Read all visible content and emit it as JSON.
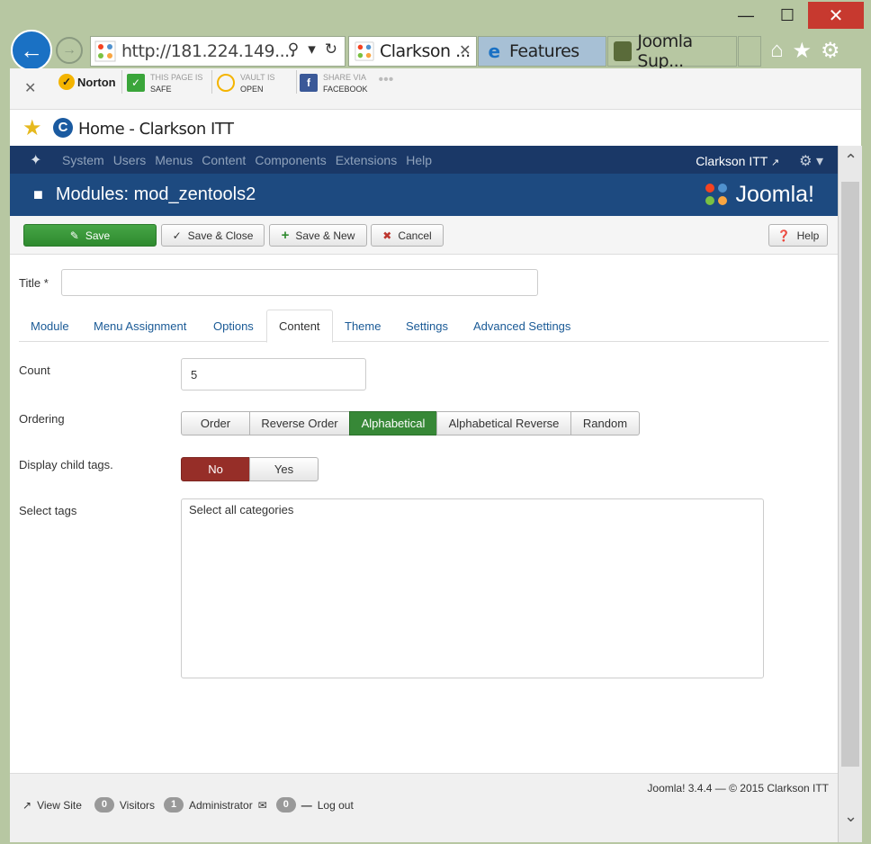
{
  "browser": {
    "url": "http://181.224.149....",
    "tabs": [
      {
        "label": "Clarkson ...",
        "active": true
      },
      {
        "label": "Features",
        "active": false
      },
      {
        "label": "Joomla Sup...",
        "active": false
      }
    ],
    "toolbar": {
      "norton": "Norton",
      "safe_top": "THIS PAGE IS",
      "safe_bottom": "SAFE",
      "vault_top": "VAULT IS",
      "vault_bottom": "OPEN",
      "share_top": "SHARE VIA",
      "share_bottom": "FACEBOOK"
    },
    "favorites_title": "Home - Clarkson ITT"
  },
  "joomla": {
    "menu": [
      "System",
      "Users",
      "Menus",
      "Content",
      "Components",
      "Extensions",
      "Help"
    ],
    "site_link": "Clarkson ITT",
    "page_title": "Modules: mod_zentools2",
    "brand": "Joomla!",
    "buttons": {
      "save": "Save",
      "save_close": "Save & Close",
      "save_new": "Save & New",
      "cancel": "Cancel",
      "help": "Help"
    },
    "form": {
      "title_label": "Title *",
      "title_value": "",
      "tabs": [
        "Module",
        "Menu Assignment",
        "Options",
        "Content",
        "Theme",
        "Settings",
        "Advanced Settings"
      ],
      "active_tab": "Content",
      "count_label": "Count",
      "count_value": "5",
      "ordering_label": "Ordering",
      "ordering_options": [
        "Order",
        "Reverse Order",
        "Alphabetical",
        "Alphabetical Reverse",
        "Random"
      ],
      "ordering_selected": "Alphabetical",
      "child_tags_label": "Display child tags.",
      "child_tags_options": [
        "No",
        "Yes"
      ],
      "child_tags_selected": "No",
      "select_tags_label": "Select tags",
      "select_tags_value": "Select all categories"
    },
    "footer": {
      "copyright": "Joomla! 3.4.4  —  © 2015 Clarkson ITT",
      "view_site": "View Site",
      "visitors_count": "0",
      "visitors_label": "Visitors",
      "admin_count": "1",
      "admin_label": "Administrator",
      "messages_count": "0",
      "logout": "Log out"
    }
  },
  "colors": {
    "nav_bg": "#1a3867",
    "header_bg": "#1d4a80",
    "save_green": "#46a546",
    "selected_green": "#378837",
    "selected_red": "#962e28",
    "link_blue": "#1a5a96"
  }
}
